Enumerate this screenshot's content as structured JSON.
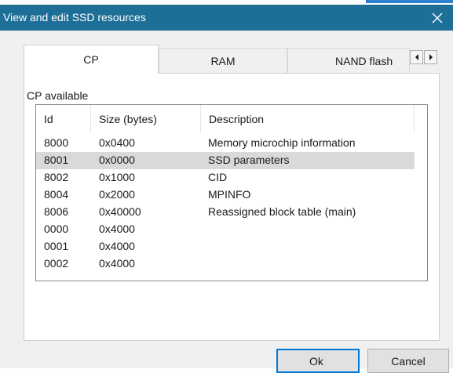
{
  "window": {
    "title": "View and edit SSD resources",
    "close_icon": "close-icon"
  },
  "tabs": [
    {
      "label": "CP",
      "active": true
    },
    {
      "label": "RAM",
      "active": false
    },
    {
      "label": "NAND flash",
      "active": false
    }
  ],
  "tab_scroll": {
    "left_icon": "triangle-left-icon",
    "right_icon": "triangle-right-icon"
  },
  "group": {
    "label": "CP available"
  },
  "list": {
    "columns": [
      "Id",
      "Size (bytes)",
      "Description"
    ],
    "rows": [
      {
        "id": "8000",
        "size": "0x0400",
        "desc": "Memory microchip information",
        "selected": false
      },
      {
        "id": "8001",
        "size": "0x0000",
        "desc": "SSD parameters",
        "selected": true
      },
      {
        "id": "8002",
        "size": "0x1000",
        "desc": "CID",
        "selected": false
      },
      {
        "id": "8004",
        "size": "0x2000",
        "desc": "MPINFO",
        "selected": false
      },
      {
        "id": "8006",
        "size": "0x40000",
        "desc": "Reassigned block table (main)",
        "selected": false
      },
      {
        "id": "0000",
        "size": "0x4000",
        "desc": "",
        "selected": false
      },
      {
        "id": "0001",
        "size": "0x4000",
        "desc": "",
        "selected": false
      },
      {
        "id": "0002",
        "size": "0x4000",
        "desc": "",
        "selected": false
      }
    ]
  },
  "buttons": {
    "ok_label": "Ok",
    "cancel_label": "Cancel"
  },
  "colors": {
    "titlebar": "#1d6f97",
    "selected_row": "#d9d9d9",
    "default_button_border": "#0078d7"
  }
}
